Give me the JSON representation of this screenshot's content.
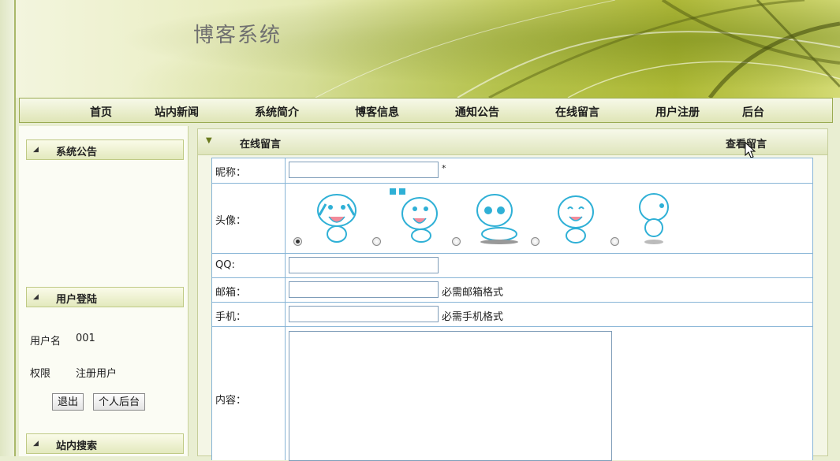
{
  "site": {
    "title": "博客系统"
  },
  "nav": {
    "items": [
      "首页",
      "站内新闻",
      "系统简介",
      "博客信息",
      "通知公告",
      "在线留言",
      "用户注册",
      "后台"
    ]
  },
  "sidebar": {
    "announcement_title": "系统公告",
    "login_title": "用户登陆",
    "username_label": "用户名",
    "username_value": "001",
    "role_label": "权限",
    "role_value": "注册用户",
    "logout_label": "退出",
    "personal_backend_label": "个人后台",
    "search_title": "站内搜索"
  },
  "main": {
    "title": "在线留言",
    "view_link": "查看留言",
    "form": {
      "nickname_label": "昵称：",
      "nickname_value": "",
      "required_mark": "*",
      "avatar_label": "头像：",
      "avatar_selected_index": 0,
      "qq_label": "QQ:",
      "qq_value": "",
      "email_label": "邮箱：",
      "email_value": "",
      "email_hint": "必需邮箱格式",
      "phone_label": "手机：",
      "phone_value": "",
      "phone_hint": "必需手机格式",
      "content_label": "内容：",
      "content_value": ""
    }
  },
  "colors": {
    "accent": "#a9b86a",
    "table_border": "#87b4d6",
    "header_bg": "#dfe5b6"
  }
}
